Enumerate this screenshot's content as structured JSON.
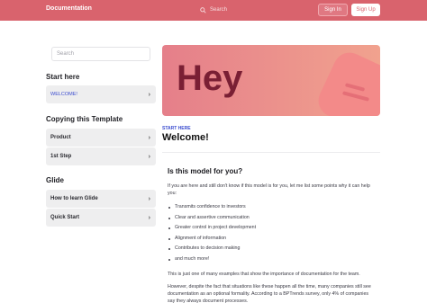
{
  "topbar": {
    "brand": "Documentation",
    "search_placeholder": "Search",
    "sign_in": "Sign In",
    "sign_up": "Sign Up"
  },
  "sidebar": {
    "search_placeholder": "Search",
    "sections": [
      {
        "title": "Start here",
        "items": [
          {
            "label": "WELCOME!"
          }
        ]
      },
      {
        "title": "Copying this Template",
        "items": [
          {
            "label": "Product"
          },
          {
            "label": "1st Step"
          }
        ]
      },
      {
        "title": "Glide",
        "items": [
          {
            "label": "How to learn Glide"
          },
          {
            "label": "Quick Start"
          }
        ]
      }
    ]
  },
  "hero": {
    "text": "Hey"
  },
  "page": {
    "kicker": "START HERE",
    "title": "Welcome!"
  },
  "content": {
    "heading": "Is this model for you?",
    "intro": "If you are here and still don't know if this model is for you, let me list some points why it can help you:",
    "bullets": [
      "Transmits confidence to investors",
      "Clear and assertive communication",
      "Greater control in project development",
      "Alignment of information",
      "Contributes to decision making",
      "and much more!"
    ],
    "para1": "This is just one of many examples that show the importance of documentation for the team.",
    "para2": "However, despite the fact that situations like these happen all the time, many companies still see documentation as an optional formality. According to a BPTrends survey, only 4% of companies say they always document processes."
  },
  "colors": {
    "accent": "#d9636d",
    "link": "#3b4ccf",
    "hero_text": "#7a1f34"
  }
}
